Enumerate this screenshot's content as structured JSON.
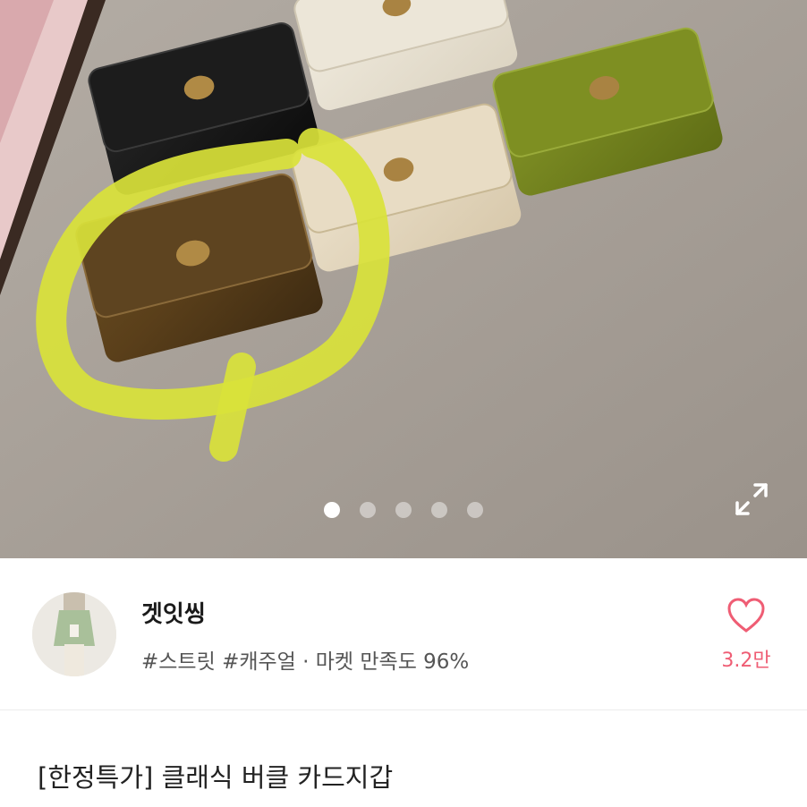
{
  "product_image": {
    "icon": "product-photo",
    "pagination": {
      "total": 5,
      "active_index": 0
    },
    "expand_icon": "expand-icon"
  },
  "seller": {
    "name": "겟잇씽",
    "meta": "#스트릿 #캐주얼 · 마켓 만족도 96%",
    "like_count": "3.2만",
    "accent": "#ef5d74"
  },
  "product": {
    "title": "[한정특가] 클래식 버클 카드지갑"
  }
}
